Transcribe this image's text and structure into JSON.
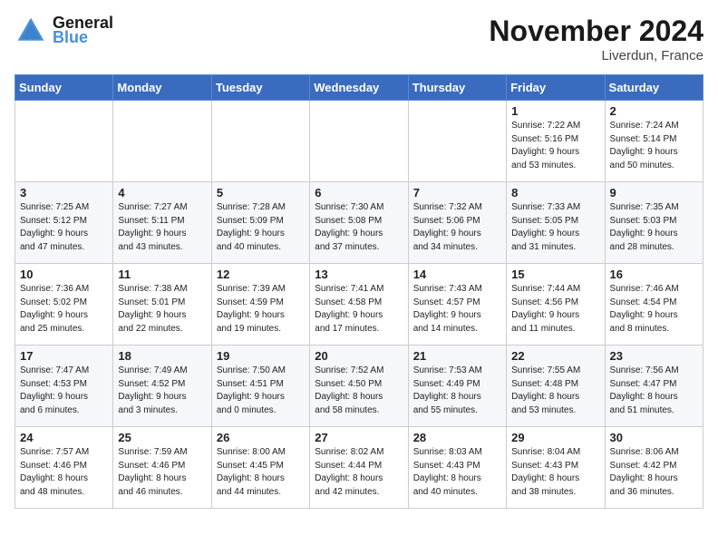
{
  "header": {
    "logo_line1": "General",
    "logo_line2": "Blue",
    "month": "November 2024",
    "location": "Liverdun, France"
  },
  "weekdays": [
    "Sunday",
    "Monday",
    "Tuesday",
    "Wednesday",
    "Thursday",
    "Friday",
    "Saturday"
  ],
  "weeks": [
    [
      {
        "day": "",
        "info": ""
      },
      {
        "day": "",
        "info": ""
      },
      {
        "day": "",
        "info": ""
      },
      {
        "day": "",
        "info": ""
      },
      {
        "day": "",
        "info": ""
      },
      {
        "day": "1",
        "info": "Sunrise: 7:22 AM\nSunset: 5:16 PM\nDaylight: 9 hours\nand 53 minutes."
      },
      {
        "day": "2",
        "info": "Sunrise: 7:24 AM\nSunset: 5:14 PM\nDaylight: 9 hours\nand 50 minutes."
      }
    ],
    [
      {
        "day": "3",
        "info": "Sunrise: 7:25 AM\nSunset: 5:12 PM\nDaylight: 9 hours\nand 47 minutes."
      },
      {
        "day": "4",
        "info": "Sunrise: 7:27 AM\nSunset: 5:11 PM\nDaylight: 9 hours\nand 43 minutes."
      },
      {
        "day": "5",
        "info": "Sunrise: 7:28 AM\nSunset: 5:09 PM\nDaylight: 9 hours\nand 40 minutes."
      },
      {
        "day": "6",
        "info": "Sunrise: 7:30 AM\nSunset: 5:08 PM\nDaylight: 9 hours\nand 37 minutes."
      },
      {
        "day": "7",
        "info": "Sunrise: 7:32 AM\nSunset: 5:06 PM\nDaylight: 9 hours\nand 34 minutes."
      },
      {
        "day": "8",
        "info": "Sunrise: 7:33 AM\nSunset: 5:05 PM\nDaylight: 9 hours\nand 31 minutes."
      },
      {
        "day": "9",
        "info": "Sunrise: 7:35 AM\nSunset: 5:03 PM\nDaylight: 9 hours\nand 28 minutes."
      }
    ],
    [
      {
        "day": "10",
        "info": "Sunrise: 7:36 AM\nSunset: 5:02 PM\nDaylight: 9 hours\nand 25 minutes."
      },
      {
        "day": "11",
        "info": "Sunrise: 7:38 AM\nSunset: 5:01 PM\nDaylight: 9 hours\nand 22 minutes."
      },
      {
        "day": "12",
        "info": "Sunrise: 7:39 AM\nSunset: 4:59 PM\nDaylight: 9 hours\nand 19 minutes."
      },
      {
        "day": "13",
        "info": "Sunrise: 7:41 AM\nSunset: 4:58 PM\nDaylight: 9 hours\nand 17 minutes."
      },
      {
        "day": "14",
        "info": "Sunrise: 7:43 AM\nSunset: 4:57 PM\nDaylight: 9 hours\nand 14 minutes."
      },
      {
        "day": "15",
        "info": "Sunrise: 7:44 AM\nSunset: 4:56 PM\nDaylight: 9 hours\nand 11 minutes."
      },
      {
        "day": "16",
        "info": "Sunrise: 7:46 AM\nSunset: 4:54 PM\nDaylight: 9 hours\nand 8 minutes."
      }
    ],
    [
      {
        "day": "17",
        "info": "Sunrise: 7:47 AM\nSunset: 4:53 PM\nDaylight: 9 hours\nand 6 minutes."
      },
      {
        "day": "18",
        "info": "Sunrise: 7:49 AM\nSunset: 4:52 PM\nDaylight: 9 hours\nand 3 minutes."
      },
      {
        "day": "19",
        "info": "Sunrise: 7:50 AM\nSunset: 4:51 PM\nDaylight: 9 hours\nand 0 minutes."
      },
      {
        "day": "20",
        "info": "Sunrise: 7:52 AM\nSunset: 4:50 PM\nDaylight: 8 hours\nand 58 minutes."
      },
      {
        "day": "21",
        "info": "Sunrise: 7:53 AM\nSunset: 4:49 PM\nDaylight: 8 hours\nand 55 minutes."
      },
      {
        "day": "22",
        "info": "Sunrise: 7:55 AM\nSunset: 4:48 PM\nDaylight: 8 hours\nand 53 minutes."
      },
      {
        "day": "23",
        "info": "Sunrise: 7:56 AM\nSunset: 4:47 PM\nDaylight: 8 hours\nand 51 minutes."
      }
    ],
    [
      {
        "day": "24",
        "info": "Sunrise: 7:57 AM\nSunset: 4:46 PM\nDaylight: 8 hours\nand 48 minutes."
      },
      {
        "day": "25",
        "info": "Sunrise: 7:59 AM\nSunset: 4:46 PM\nDaylight: 8 hours\nand 46 minutes."
      },
      {
        "day": "26",
        "info": "Sunrise: 8:00 AM\nSunset: 4:45 PM\nDaylight: 8 hours\nand 44 minutes."
      },
      {
        "day": "27",
        "info": "Sunrise: 8:02 AM\nSunset: 4:44 PM\nDaylight: 8 hours\nand 42 minutes."
      },
      {
        "day": "28",
        "info": "Sunrise: 8:03 AM\nSunset: 4:43 PM\nDaylight: 8 hours\nand 40 minutes."
      },
      {
        "day": "29",
        "info": "Sunrise: 8:04 AM\nSunset: 4:43 PM\nDaylight: 8 hours\nand 38 minutes."
      },
      {
        "day": "30",
        "info": "Sunrise: 8:06 AM\nSunset: 4:42 PM\nDaylight: 8 hours\nand 36 minutes."
      }
    ]
  ]
}
